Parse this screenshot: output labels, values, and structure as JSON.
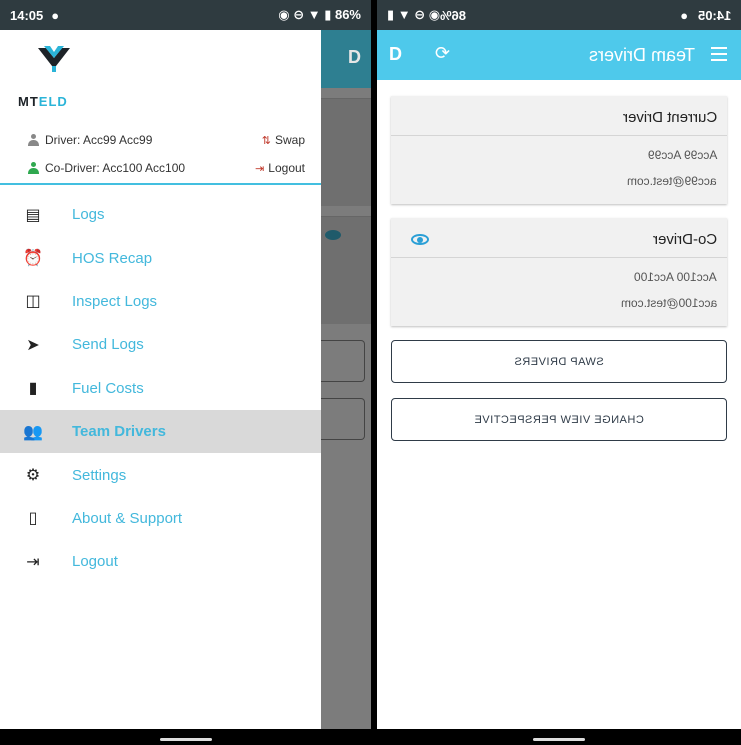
{
  "left": {
    "status": {
      "time": "14:05",
      "battery": "86%"
    },
    "logo": {
      "mark": "logo-mark",
      "word_main": "MT",
      "word_accent": "ELD"
    },
    "accounts": {
      "driver": "Driver: Acc99 Acc99",
      "co_driver": "Co-Driver: Acc100 Acc100",
      "swap": "Swap",
      "logout": "Logout"
    },
    "menu": [
      {
        "label": "Logs",
        "icon": "logs-icon"
      },
      {
        "label": "HOS Recap",
        "icon": "alarm-icon"
      },
      {
        "label": "Inspect Logs",
        "icon": "inspect-icon"
      },
      {
        "label": "Send Logs",
        "icon": "send-icon"
      },
      {
        "label": "Fuel Costs",
        "icon": "fuel-icon"
      },
      {
        "label": "Team Drivers",
        "icon": "team-icon",
        "active": true
      },
      {
        "label": "Settings",
        "icon": "gear-icon"
      },
      {
        "label": "About & Support",
        "icon": "phone-icon"
      },
      {
        "label": "Logout",
        "icon": "logout-icon"
      }
    ],
    "bg_icon": "D"
  },
  "right": {
    "status": {
      "time": "14:05",
      "battery": "86%"
    },
    "appbar": {
      "title": "Team Drivers",
      "d_icon": "D"
    },
    "current_driver": {
      "title": "Current Driver",
      "name": "Acc99 Acc99",
      "email": "acc99@test.com"
    },
    "co_driver": {
      "title": "Co-Driver",
      "name": "Acc100 Acc100",
      "email": "acc100@test.com"
    },
    "buttons": {
      "swap": "SWAP DRIVERS",
      "perspective": "CHANGE VIEW PERSPECTIVE"
    }
  },
  "colors": {
    "accent": "#43bfe0",
    "appbar": "#4ec9eb",
    "statusbar": "#2f3b40"
  }
}
